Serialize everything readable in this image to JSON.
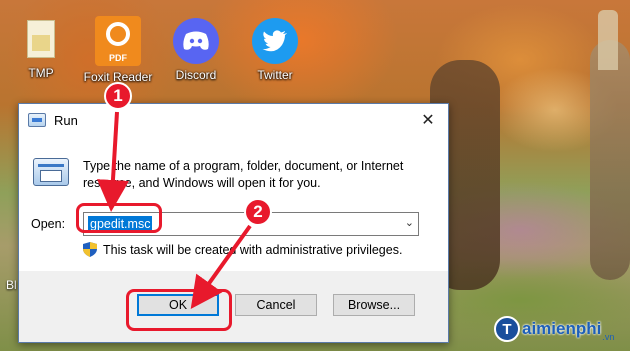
{
  "desktop": {
    "icons": [
      {
        "label": "TMP",
        "icon": "folder-icon"
      },
      {
        "label": "Foxit Reader",
        "icon": "foxit-reader-icon",
        "badge_text": "PDF"
      },
      {
        "label": "Discord",
        "icon": "discord-icon"
      },
      {
        "label": "Twitter",
        "icon": "twitter-icon"
      }
    ],
    "partial_label": "Bl"
  },
  "run_dialog": {
    "title": "Run",
    "description": "Type the name of a program, folder, document, or Internet resource, and Windows will open it for you.",
    "open_label": "Open:",
    "input_value": "gpedit.msc",
    "admin_note": "This task will be created with administrative privileges.",
    "buttons": {
      "ok": "OK",
      "cancel": "Cancel",
      "browse": "Browse..."
    },
    "close_glyph": "✕"
  },
  "annotations": {
    "step1": "1",
    "step2": "2"
  },
  "watermark": {
    "text": "aimienphi",
    "tld": ".vn"
  },
  "colors": {
    "annotation_red": "#e8192c",
    "selection_blue": "#0078d7",
    "discord": "#5865f2",
    "twitter": "#1d9bf0",
    "foxit": "#f08a1d"
  }
}
